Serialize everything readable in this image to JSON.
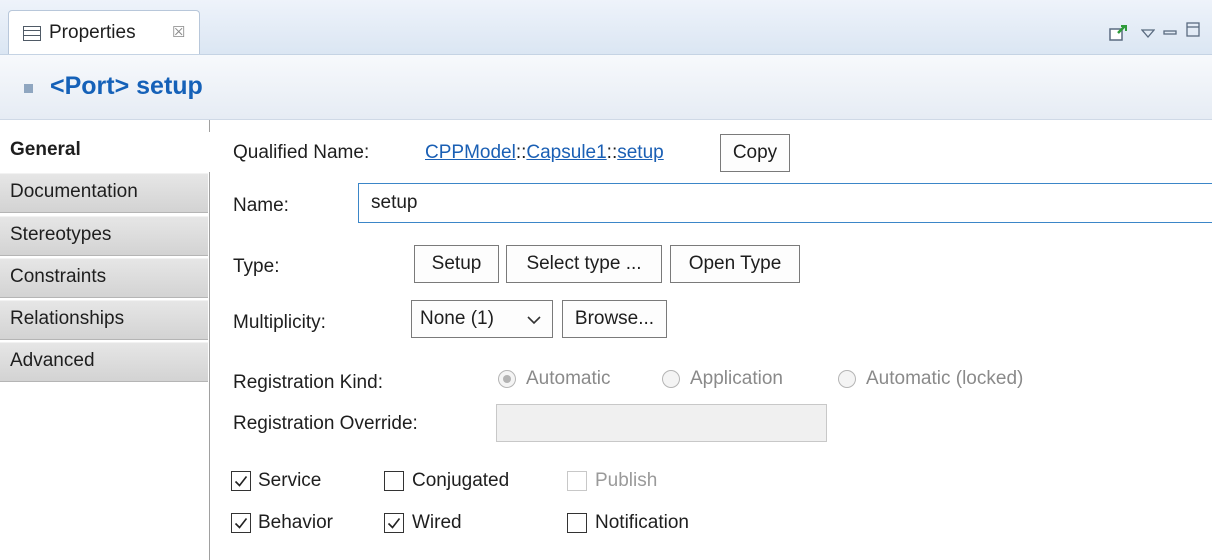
{
  "view_tab": {
    "title": "Properties",
    "close_glyph": "☒"
  },
  "header": {
    "title": "<Port> setup"
  },
  "side_tabs": [
    {
      "label": "General",
      "selected": true
    },
    {
      "label": "Documentation"
    },
    {
      "label": "Stereotypes"
    },
    {
      "label": "Constraints"
    },
    {
      "label": "Relationships"
    },
    {
      "label": "Advanced"
    }
  ],
  "form": {
    "qualified_name": {
      "label": "Qualified Name:",
      "parts": [
        "CPPModel",
        "::",
        "Capsule1",
        "::",
        "setup"
      ],
      "copy_button": "Copy"
    },
    "name": {
      "label": "Name:",
      "value": "setup"
    },
    "type": {
      "label": "Type:",
      "value_button": "Setup",
      "select_button": "Select type ...",
      "open_button": "Open Type"
    },
    "multiplicity": {
      "label": "Multiplicity:",
      "selected": "None (1)",
      "browse_button": "Browse..."
    },
    "registration_kind": {
      "label": "Registration Kind:",
      "options": [
        {
          "label": "Automatic",
          "checked": true
        },
        {
          "label": "Application",
          "checked": false
        },
        {
          "label": "Automatic (locked)",
          "checked": false
        }
      ]
    },
    "registration_override": {
      "label": "Registration Override:",
      "value": ""
    },
    "checkboxes": {
      "service": {
        "label": "Service",
        "checked": true,
        "enabled": true
      },
      "conjugated": {
        "label": "Conjugated",
        "checked": false,
        "enabled": true
      },
      "publish": {
        "label": "Publish",
        "checked": false,
        "enabled": false
      },
      "behavior": {
        "label": "Behavior",
        "checked": true,
        "enabled": true
      },
      "wired": {
        "label": "Wired",
        "checked": true,
        "enabled": true
      },
      "notification": {
        "label": "Notification",
        "checked": false,
        "enabled": true
      }
    }
  },
  "colors": {
    "accent": "#1561b8",
    "link": "#1a5fb4",
    "focus_border": "#3b86c8"
  },
  "icons": [
    "properties-view-icon",
    "close-tab-icon",
    "pin-icon",
    "view-menu-icon",
    "minimize-icon",
    "maximize-icon",
    "port-icon",
    "checkmark-icon",
    "dropdown-chevron-icon"
  ]
}
